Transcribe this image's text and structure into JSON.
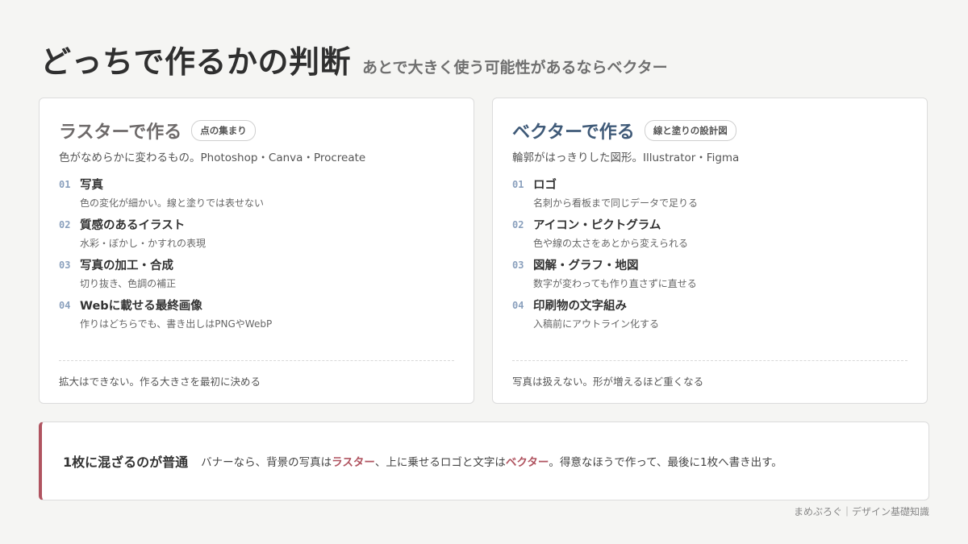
{
  "header": {
    "title": "どっちで作るかの判断",
    "subtitle": "あとで大きく使う可能性があるならベクター"
  },
  "raster": {
    "title": "ラスターで作る",
    "badge": "点の集まり",
    "description": "色がなめらかに変わるもの。Photoshop・Canva・Procreate",
    "items": [
      {
        "num": "01",
        "title": "写真",
        "sub": "色の変化が細かい。線と塗りでは表せない"
      },
      {
        "num": "02",
        "title": "質感のあるイラスト",
        "sub": "水彩・ぼかし・かすれの表現"
      },
      {
        "num": "03",
        "title": "写真の加工・合成",
        "sub": "切り抜き、色調の補正"
      },
      {
        "num": "04",
        "title": "Webに載せる最終画像",
        "sub": "作りはどちらでも、書き出しはPNGやWebP"
      }
    ],
    "note": "拡大はできない。作る大きさを最初に決める"
  },
  "vector": {
    "title": "ベクターで作る",
    "badge": "線と塗りの設計図",
    "description": "輪郭がはっきりした図形。Illustrator・Figma",
    "items": [
      {
        "num": "01",
        "title": "ロゴ",
        "sub": "名刺から看板まで同じデータで足りる"
      },
      {
        "num": "02",
        "title": "アイコン・ピクトグラム",
        "sub": "色や線の太さをあとから変えられる"
      },
      {
        "num": "03",
        "title": "図解・グラフ・地図",
        "sub": "数字が変わっても作り直さずに直せる"
      },
      {
        "num": "04",
        "title": "印刷物の文字組み",
        "sub": "入稿前にアウトライン化する"
      }
    ],
    "note": "写真は扱えない。形が増えるほど重くなる"
  },
  "banner": {
    "heading": "1枚に混ざるのが普通",
    "text_1": "バナーなら、背景の写真は",
    "highlight_1": "ラスター",
    "text_2": "、上に乗せるロゴと文字は",
    "highlight_2": "ベクター",
    "text_3": "。得意なほうで作って、最後に1枚へ書き出す。",
    "accent_color": "#b05460"
  },
  "footer": "まめぶろぐ｜デザイン基礎知識"
}
